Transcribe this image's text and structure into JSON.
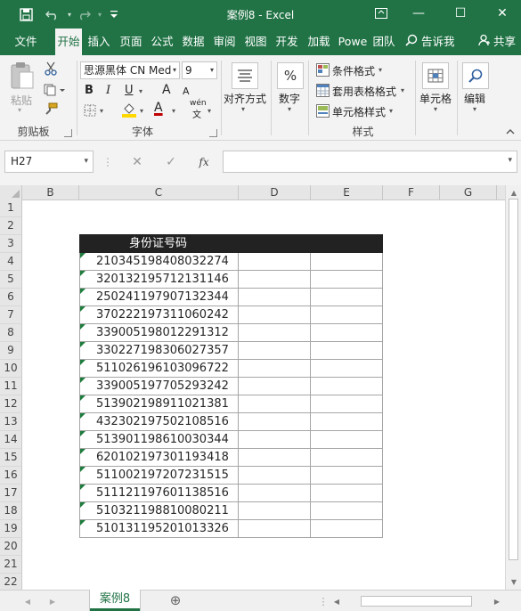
{
  "window": {
    "title": "案例8  -  Excel",
    "minimize_glyph": "—",
    "maximize_glyph": "☐",
    "close_glyph": "✕",
    "restore_glyph": "⧉"
  },
  "quick_access": {
    "save_icon": "save-icon",
    "undo_icon": "undo-icon",
    "redo_icon": "redo-icon",
    "customize_icon": "customize-icon"
  },
  "tabs": [
    "文件",
    "开始",
    "插入",
    "页面",
    "公式",
    "数据",
    "审阅",
    "视图",
    "开发",
    "加载",
    "Powe",
    "团队"
  ],
  "tell_me": "告诉我",
  "share": "共享",
  "ribbon": {
    "clipboard": {
      "paste": "粘贴",
      "group": "剪贴板"
    },
    "font": {
      "name": "思源黑体 CN Med",
      "size": "9",
      "bold": "B",
      "italic": "I",
      "underline": "U",
      "grow": "A",
      "shrink": "A",
      "color_letter": "A",
      "phonetic": "wén",
      "group": "字体"
    },
    "alignment": {
      "label": "对齐方式"
    },
    "number": {
      "label": "数字",
      "symbol": "%"
    },
    "styles": {
      "conditional": "条件格式",
      "table": "套用表格格式",
      "cell": "单元格样式",
      "group": "样式"
    },
    "cells": {
      "label": "单元格"
    },
    "editing": {
      "label": "编辑"
    }
  },
  "formula_bar": {
    "name_box": "H27",
    "fx": "fx",
    "cancel": "✕",
    "enter": "✓",
    "value": ""
  },
  "columns": [
    "B",
    "C",
    "D",
    "E",
    "F",
    "G"
  ],
  "rows": [
    "1",
    "2",
    "3",
    "4",
    "5",
    "6",
    "7",
    "8",
    "9",
    "10",
    "11",
    "12",
    "13",
    "14",
    "15",
    "16",
    "17",
    "18",
    "19",
    "20",
    "21",
    "22"
  ],
  "table": {
    "header": "身份证号码",
    "ids": [
      "210345198408032274",
      "320132195712131146",
      "250241197907132344",
      "370222197311060242",
      "339005198012291312",
      "330227198306027357",
      "511026196103096722",
      "339005197705293242",
      "513902198911021381",
      "432302197502108516",
      "513901198610030344",
      "620102197301193418",
      "511002197207231515",
      "511121197601138516",
      "510321198810080211",
      "510131195201013326"
    ]
  },
  "sheet": {
    "active_tab": "案例8",
    "add_glyph": "⊕"
  },
  "colors": {
    "excel_green": "#217346",
    "header_fill": "#222222",
    "error_indicator": "#1e7d3d"
  }
}
